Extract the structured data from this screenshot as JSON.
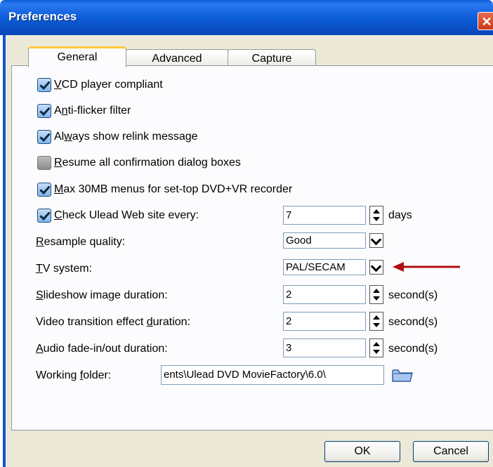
{
  "window": {
    "title": "Preferences",
    "close_glyph": "✕"
  },
  "tabs": [
    {
      "label": "General",
      "active": true
    },
    {
      "label": "Advanced",
      "active": false
    },
    {
      "label": "Capture",
      "active": false
    }
  ],
  "options": {
    "vcd": {
      "pre": "",
      "mn": "V",
      "post": "CD player compliant",
      "checked": true
    },
    "antiflicker": {
      "pre": "A",
      "mn": "n",
      "post": "ti-flicker filter",
      "checked": true
    },
    "relink": {
      "pre": "Al",
      "mn": "w",
      "post": "ays show relink message",
      "checked": true
    },
    "resume": {
      "pre": "",
      "mn": "R",
      "post": "esume all confirmation dialog boxes",
      "checked": false
    },
    "max30": {
      "pre": "",
      "mn": "M",
      "post": "ax 30MB menus for set-top DVD+VR recorder",
      "checked": true
    },
    "check_ulead": {
      "pre": "",
      "mn": "C",
      "post": "heck Ulead Web site every:",
      "checked": true,
      "value": "7",
      "unit": "days"
    }
  },
  "resample": {
    "pre": "",
    "mn": "R",
    "post": "esample quality:",
    "value": "Good"
  },
  "tv": {
    "pre": "",
    "mn": "T",
    "post": "V system:",
    "value": "PAL/SECAM"
  },
  "slideshow": {
    "pre": "",
    "mn": "S",
    "post": "lideshow image duration:",
    "value": "2",
    "unit": "second(s)"
  },
  "transition": {
    "pre": "Video transition effect ",
    "mn": "d",
    "post": "uration:",
    "value": "2",
    "unit": "second(s)"
  },
  "fade": {
    "pre": "",
    "mn": "A",
    "post": "udio fade-in/out duration:",
    "value": "3",
    "unit": "second(s)"
  },
  "folder": {
    "pre": "Working ",
    "mn": "f",
    "post": "older:",
    "value": "ents\\Ulead DVD MovieFactory\\6.0\\"
  },
  "buttons": {
    "ok": "OK",
    "cancel": "Cancel"
  },
  "colors": {
    "titlebar": "#0b5ad6",
    "arrow": "#b01010",
    "dialog_bg": "#ece9d8"
  }
}
